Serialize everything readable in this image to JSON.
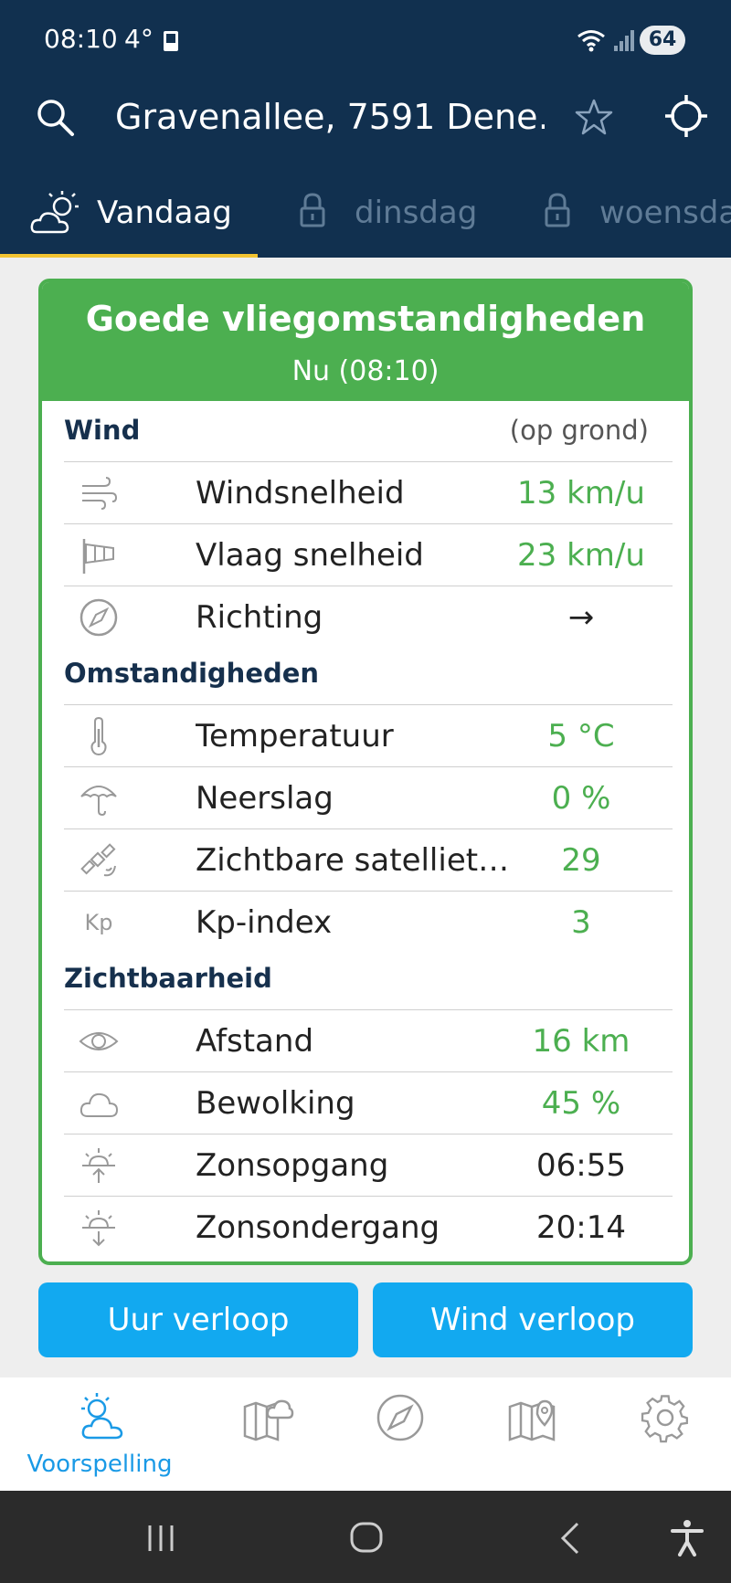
{
  "status_bar": {
    "time": "08:10",
    "temperature": "4°",
    "battery": "64"
  },
  "header": {
    "location": "Gravenallee, 7591 Dene…",
    "search_icon": "search-icon",
    "favorite_icon": "star-icon",
    "locate_icon": "crosshair-icon"
  },
  "tabs": [
    {
      "label": "Vandaag",
      "icon": "partly-cloudy-icon",
      "active": true
    },
    {
      "label": "dinsdag",
      "icon": "lock-icon",
      "active": false
    },
    {
      "label": "woensda",
      "icon": "lock-icon",
      "active": false
    }
  ],
  "card": {
    "title": "Goede vliegomstandigheden",
    "subtitle": "Nu (08:10)",
    "wind": {
      "title": "Wind",
      "note": "(op grond)",
      "rows": [
        {
          "label": "Windsnelheid",
          "value": "13 km/u",
          "icon": "wind-icon"
        },
        {
          "label": "Vlaag snelheid",
          "value": "23 km/u",
          "icon": "windsock-icon"
        },
        {
          "label": "Richting",
          "value": "→",
          "icon": "compass-icon"
        }
      ]
    },
    "conditions": {
      "title": "Omstandigheden",
      "rows": [
        {
          "label": "Temperatuur",
          "value": "5 °C",
          "icon": "thermometer-icon"
        },
        {
          "label": "Neerslag",
          "value": "0 %",
          "icon": "umbrella-icon"
        },
        {
          "label": "Zichtbare satelliet…",
          "value": "29",
          "icon": "satellite-icon"
        },
        {
          "label": "Kp-index",
          "value": "3",
          "icon_text": "Kp"
        }
      ]
    },
    "visibility": {
      "title": "Zichtbaarheid",
      "rows": [
        {
          "label": "Afstand",
          "value": "16 km",
          "icon": "eye-icon"
        },
        {
          "label": "Bewolking",
          "value": "45 %",
          "icon": "cloud-icon"
        },
        {
          "label": "Zonsopgang",
          "value": "06:55",
          "icon": "sunrise-icon"
        },
        {
          "label": "Zonsondergang",
          "value": "20:14",
          "icon": "sunset-icon"
        }
      ]
    }
  },
  "buttons": {
    "hourly": "Uur verloop",
    "wind": "Wind verloop"
  },
  "bottom_nav": {
    "forecast_label": "Voorspelling"
  },
  "colors": {
    "header_bg": "#11304f",
    "good_green": "#4caf50",
    "button_blue": "#12a9f0",
    "tab_underline": "#f3c331"
  }
}
